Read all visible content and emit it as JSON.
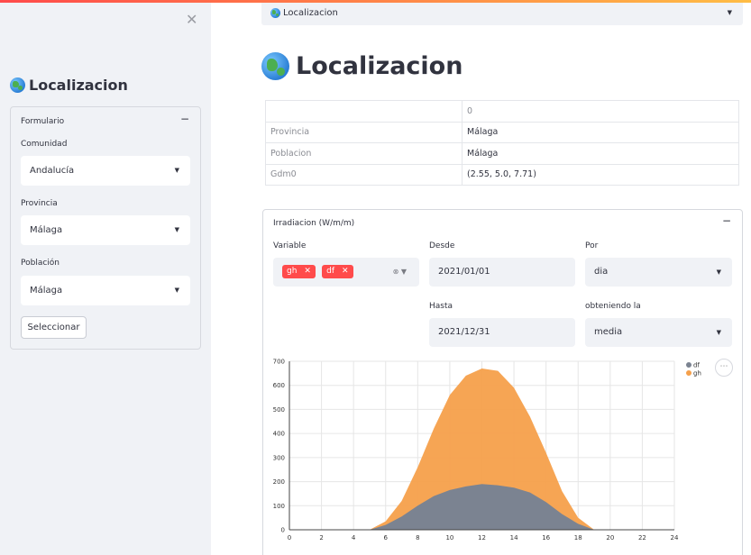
{
  "sidebar": {
    "title": "Localizacion",
    "form": {
      "header": "Formulario",
      "collapse_symbol": "−",
      "fields": [
        {
          "label": "Comunidad",
          "value": "Andalucía"
        },
        {
          "label": "Provincia",
          "value": "Málaga"
        },
        {
          "label": "Población",
          "value": "Málaga"
        }
      ],
      "submit_label": "Seleccionar"
    },
    "close_symbol": "✕"
  },
  "top_expander": {
    "label": "Localizacion",
    "icon": "globe-icon"
  },
  "main": {
    "title": "Localizacion",
    "table": {
      "header": [
        "",
        "0"
      ],
      "rows": [
        [
          "Provincia",
          "Málaga"
        ],
        [
          "Poblacion",
          "Málaga"
        ],
        [
          "Gdm0",
          "(2.55, 5.0, 7.71)"
        ]
      ]
    }
  },
  "irradiation": {
    "header": "Irradiacion (W/m/m)",
    "collapse_symbol": "−",
    "variable": {
      "label": "Variable",
      "tags": [
        "gh",
        "df"
      ]
    },
    "desde": {
      "label": "Desde",
      "value": "2021/01/01"
    },
    "por": {
      "label": "Por",
      "value": "dia"
    },
    "hasta": {
      "label": "Hasta",
      "value": "2021/12/31"
    },
    "obteniendo": {
      "label": "obteniendo la",
      "value": "media"
    },
    "more_label": "⋯"
  },
  "colors": {
    "accent": "#ff4b4b",
    "gh": "#f5a04b",
    "df": "#7b8391"
  },
  "chart_data": {
    "type": "area",
    "x": [
      0,
      1,
      2,
      3,
      4,
      5,
      6,
      7,
      8,
      9,
      10,
      11,
      12,
      13,
      14,
      15,
      16,
      17,
      18,
      19,
      20,
      21,
      22,
      23,
      24
    ],
    "series": [
      {
        "name": "df",
        "values": [
          0,
          0,
          0,
          0,
          0,
          0,
          20,
          55,
          100,
          140,
          165,
          180,
          190,
          185,
          175,
          155,
          115,
          65,
          25,
          0,
          0,
          0,
          0,
          0,
          0
        ]
      },
      {
        "name": "gh",
        "values": [
          0,
          0,
          0,
          0,
          0,
          0,
          35,
          120,
          260,
          420,
          560,
          640,
          670,
          660,
          590,
          470,
          320,
          160,
          50,
          0,
          0,
          0,
          0,
          0,
          0
        ]
      }
    ],
    "xticks": [
      0,
      2,
      4,
      6,
      8,
      10,
      12,
      14,
      16,
      18,
      20,
      22,
      24
    ],
    "yticks": [
      0,
      100,
      200,
      300,
      400,
      500,
      600,
      700
    ],
    "xlim": [
      0,
      24
    ],
    "ylim": [
      0,
      700
    ],
    "grid": true,
    "legend": "top-right"
  }
}
